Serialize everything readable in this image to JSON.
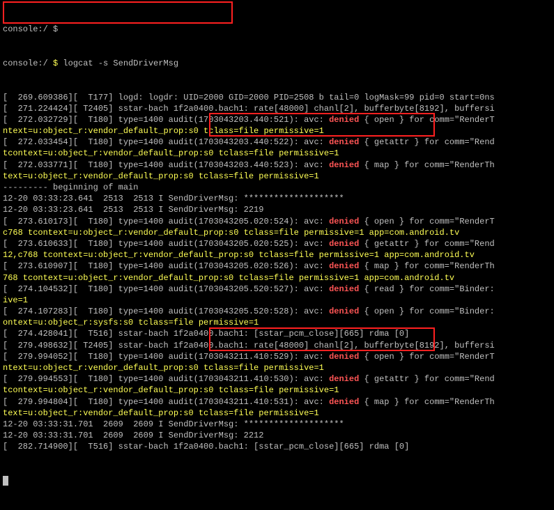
{
  "prompts": {
    "line1": "console:/ $",
    "line2_pre": "console:/ ",
    "line2_dollar": "$ ",
    "line2_cmd": "logcat -s SendDriverMsg"
  },
  "lines": [
    {
      "t": "[  269.609386][  T177] logd: logdr: UID=2000 GID=2000 PID=2508 b tail=0 logMask=99 pid=0 start=0ns"
    },
    {
      "t": "[  271.224424][ T2405] sstar-bach 1f2a0400.bach1: rate[48000] chanl[2], bufferbyte[8192], buffersi"
    },
    {
      "pre": "[  272.032729][  T180] type=1400 audit(1703043203.440:521): avc: ",
      "den": "denied",
      "post": " { open } for comm=\"RenderT"
    },
    {
      "y": "ntext=u:object_r:vendor_default_prop:s0 tclass=file permissive=1"
    },
    {
      "pre": "[  272.033454][  T180] type=1400 audit(1703043203.440:522): avc: ",
      "den": "denied",
      "post": " { getattr } for comm=\"Rend"
    },
    {
      "y": "tcontext=u:object_r:vendor_default_prop:s0 tclass=file permissive=1"
    },
    {
      "pre": "[  272.033771][  T180] type=1400 audit(1703043203.440:523): avc: ",
      "den": "denied",
      "post": " { map } for comm=\"RenderTh"
    },
    {
      "y": "text=u:object_r:vendor_default_prop:s0 tclass=file permissive=1"
    },
    {
      "t": "--------- beginning of main"
    },
    {
      "t": "12-20 03:33:23.641  2513  2513 I SendDriverMsg: ********************"
    },
    {
      "t": "12-20 03:33:23.641  2513  2513 I SendDriverMsg: 2219"
    },
    {
      "pre": "[  273.610173][  T180] type=1400 audit(1703043205.020:524): avc: ",
      "den": "denied",
      "post": " { open } for comm=\"RenderT"
    },
    {
      "y": "c768 tcontext=u:object_r:vendor_default_prop:s0 tclass=file permissive=1 app=com.android.tv"
    },
    {
      "pre": "[  273.610633][  T180] type=1400 audit(1703043205.020:525): avc: ",
      "den": "denied",
      "post": " { getattr } for comm=\"Rend"
    },
    {
      "y": "12,c768 tcontext=u:object_r:vendor_default_prop:s0 tclass=file permissive=1 app=com.android.tv"
    },
    {
      "pre": "[  273.610907][  T180] type=1400 audit(1703043205.020:526): avc: ",
      "den": "denied",
      "post": " { map } for comm=\"RenderTh"
    },
    {
      "y": "768 tcontext=u:object_r:vendor_default_prop:s0 tclass=file permissive=1 app=com.android.tv"
    },
    {
      "pre": "[  274.104532][  T180] type=1400 audit(1703043205.520:527): avc: ",
      "den": "denied",
      "post": " { read } for comm=\"Binder:"
    },
    {
      "y": "ive=1"
    },
    {
      "pre": "[  274.107283][  T180] type=1400 audit(1703043205.520:528): avc: ",
      "den": "denied",
      "post": " { open } for comm=\"Binder:"
    },
    {
      "y": "ontext=u:object_r:sysfs:s0 tclass=file permissive=1"
    },
    {
      "t": "[  274.428041][  T516] sstar-bach 1f2a0400.bach1: [sstar_pcm_close][665] rdma [0]"
    },
    {
      "t": "[  279.498632][ T2405] sstar-bach 1f2a0400.bach1: rate[48000] chanl[2], bufferbyte[8192], buffersi"
    },
    {
      "pre": "[  279.994052][  T180] type=1400 audit(1703043211.410:529): avc: ",
      "den": "denied",
      "post": " { open } for comm=\"RenderT"
    },
    {
      "y": "ntext=u:object_r:vendor_default_prop:s0 tclass=file permissive=1"
    },
    {
      "pre": "[  279.994553][  T180] type=1400 audit(1703043211.410:530): avc: ",
      "den": "denied",
      "post": " { getattr } for comm=\"Rend"
    },
    {
      "y": "tcontext=u:object_r:vendor_default_prop:s0 tclass=file permissive=1"
    },
    {
      "pre": "[  279.994804][  T180] type=1400 audit(1703043211.410:531): avc: ",
      "den": "denied",
      "post": " { map } for comm=\"RenderTh"
    },
    {
      "y": "text=u:object_r:vendor_default_prop:s0 tclass=file permissive=1"
    },
    {
      "t": "12-20 03:33:31.701  2609  2609 I SendDriverMsg: ********************"
    },
    {
      "t": "12-20 03:33:31.701  2609  2609 I SendDriverMsg: 2212"
    },
    {
      "t": "[  282.714900][  T516] sstar-bach 1f2a0400.bach1: [sstar_pcm_close][665] rdma [0]"
    }
  ]
}
